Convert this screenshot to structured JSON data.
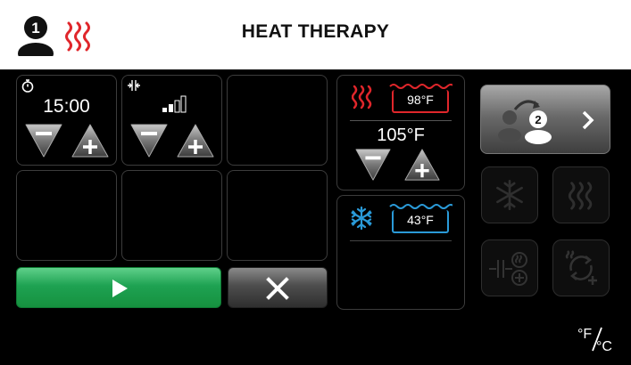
{
  "header": {
    "title": "HEAT THERAPY",
    "user_number": "1"
  },
  "timer": {
    "value": "15:00"
  },
  "intensity": {
    "level": 2,
    "max": 4
  },
  "heat": {
    "current_temp": "98°F",
    "target_temp": "105°F"
  },
  "cold": {
    "current_temp": "43°F"
  },
  "switch_user": {
    "user_number": "2"
  },
  "units_toggle": {
    "label": "°F/°C"
  },
  "colors": {
    "heat": "#e0262b",
    "cold": "#2a9ad8",
    "start_green": "#1ea252",
    "header_bg": "#ffffff",
    "screen_bg": "#000000"
  },
  "icons": [
    "user-1-icon",
    "heat-waves-icon",
    "timer-icon",
    "intensity-icon",
    "decrease-icon",
    "increase-icon",
    "play-icon",
    "close-icon",
    "snowflake-icon",
    "switch-user-icon",
    "chevron-right-icon",
    "heat-cold-cycle-icon",
    "alternate-icon"
  ]
}
